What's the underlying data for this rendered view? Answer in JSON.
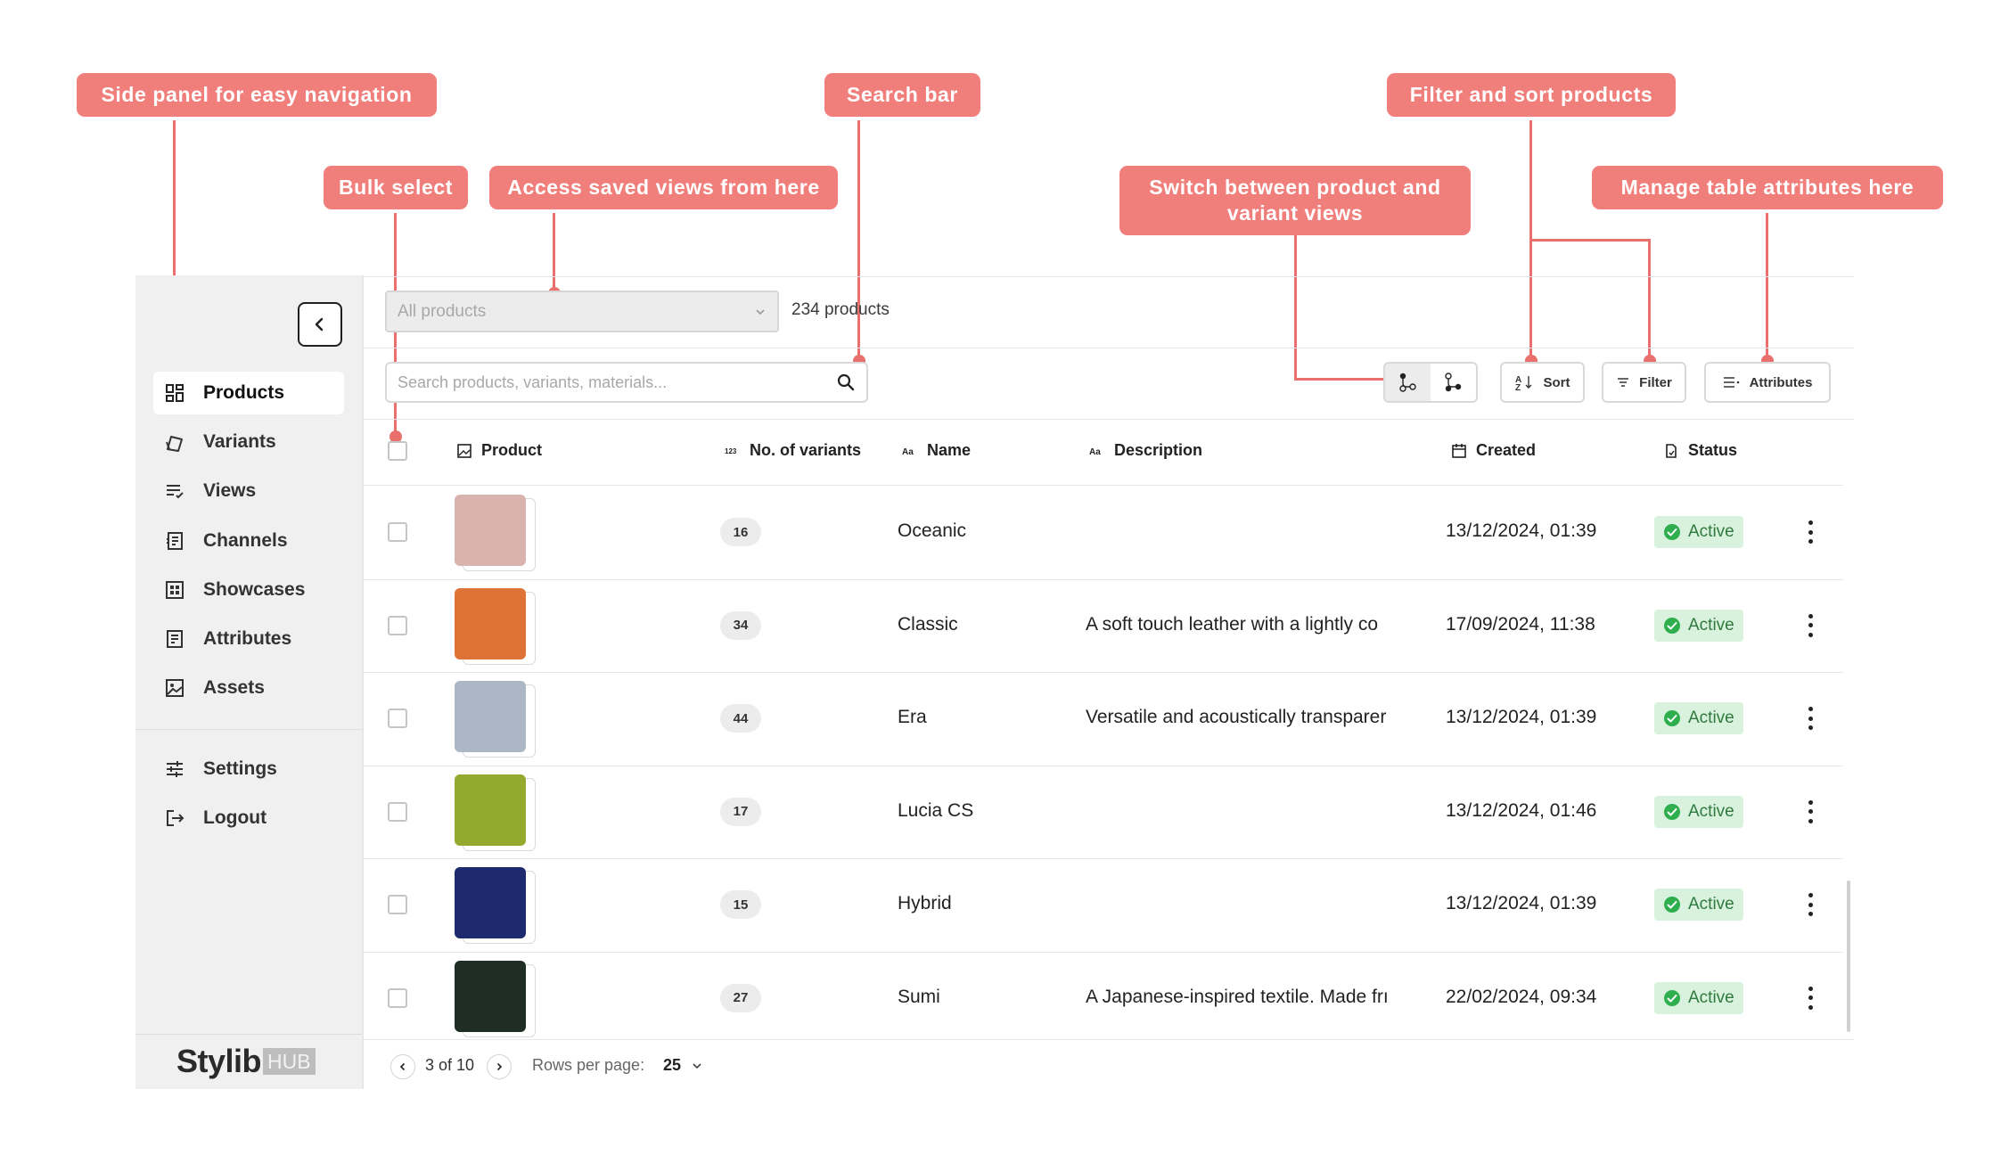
{
  "callouts": {
    "side_panel": "Side panel for easy navigation",
    "search_bar": "Search bar",
    "filter_sort": "Filter and sort products",
    "bulk_select": "Bulk select",
    "saved_views": "Access saved views from here",
    "switch_views": "Switch between product and variant views",
    "manage_attributes": "Manage table attributes here"
  },
  "sidebar": {
    "items": [
      {
        "label": "Products",
        "icon": "grid-icon",
        "active": true
      },
      {
        "label": "Variants",
        "icon": "swatches-icon",
        "active": false
      },
      {
        "label": "Views",
        "icon": "list-view-icon",
        "active": false
      },
      {
        "label": "Channels",
        "icon": "channels-icon",
        "active": false
      },
      {
        "label": "Showcases",
        "icon": "showcases-icon",
        "active": false
      },
      {
        "label": "Attributes",
        "icon": "attributes-icon",
        "active": false
      },
      {
        "label": "Assets",
        "icon": "image-icon",
        "active": false
      }
    ],
    "bottom_items": [
      {
        "label": "Settings",
        "icon": "sliders-icon"
      },
      {
        "label": "Logout",
        "icon": "logout-icon"
      }
    ],
    "logo": {
      "wordmark": "Stylib",
      "suffix": "HUB"
    }
  },
  "toolbar": {
    "views_select": "All products",
    "count": "234 products",
    "search_placeholder": "Search products, variants, materials...",
    "sort_label": "Sort",
    "filter_label": "Filter",
    "attributes_label": "Attributes"
  },
  "table": {
    "columns": [
      "Product",
      "No. of variants",
      "Name",
      "Description",
      "Created",
      "Status"
    ],
    "rows": [
      {
        "swatch": "#d9b4ae",
        "variants": "16",
        "name": "Oceanic",
        "description": "",
        "created": "13/12/2024, 01:39",
        "status": "Active"
      },
      {
        "swatch": "#de7338",
        "variants": "34",
        "name": "Classic",
        "description": "A soft touch leather with a lightly co",
        "created": "17/09/2024, 11:38",
        "status": "Active"
      },
      {
        "swatch": "#adb6c4",
        "variants": "44",
        "name": "Era",
        "description": "Versatile and acoustically transparer",
        "created": "13/12/2024, 01:39",
        "status": "Active"
      },
      {
        "swatch": "#94aa2e",
        "variants": "17",
        "name": "Lucia CS",
        "description": "",
        "created": "13/12/2024, 01:46",
        "status": "Active"
      },
      {
        "swatch": "#1d2a6e",
        "variants": "15",
        "name": "Hybrid",
        "description": "",
        "created": "13/12/2024, 01:39",
        "status": "Active"
      },
      {
        "swatch": "#1e2e24",
        "variants": "27",
        "name": "Sumi",
        "description": "A Japanese-inspired textile. Made frı",
        "created": "22/02/2024, 09:34",
        "status": "Active"
      }
    ]
  },
  "pagination": {
    "page": "3 of 10",
    "rows_per_page_label": "Rows per page:",
    "rows_per_page": "25"
  },
  "colors": {
    "callout": "#f07f7c",
    "status_bg": "#d9f2dd",
    "status_text": "#2f7a3e",
    "sidebar_bg": "#f0f0f0"
  }
}
